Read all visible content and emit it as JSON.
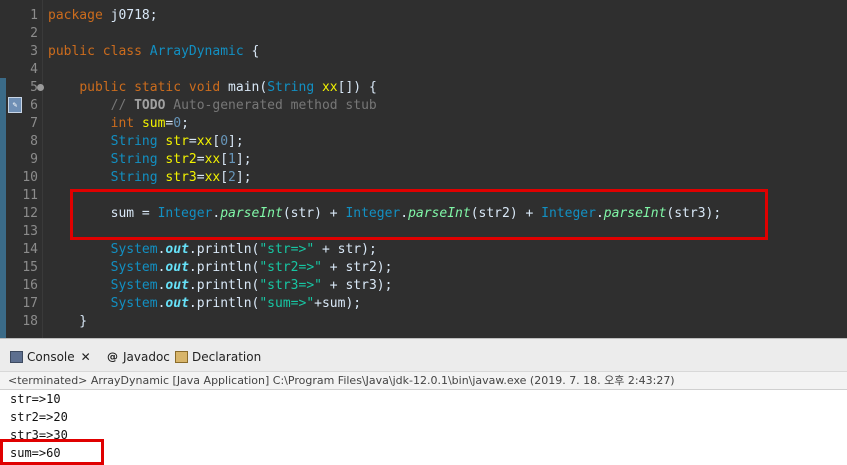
{
  "editor": {
    "lines": [
      {
        "n": "1",
        "tokens": [
          [
            "kw",
            "package"
          ],
          [
            "plain",
            " j0718;"
          ]
        ]
      },
      {
        "n": "2",
        "tokens": []
      },
      {
        "n": "3",
        "tokens": [
          [
            "kw",
            "public"
          ],
          [
            "plain",
            " "
          ],
          [
            "kw",
            "class"
          ],
          [
            "plain",
            " "
          ],
          [
            "ty",
            "ArrayDynamic"
          ],
          [
            "plain",
            " {"
          ]
        ]
      },
      {
        "n": "4",
        "tokens": []
      },
      {
        "n": "5",
        "tokens": [
          [
            "plain",
            "    "
          ],
          [
            "kw",
            "public"
          ],
          [
            "plain",
            " "
          ],
          [
            "kw",
            "static"
          ],
          [
            "plain",
            " "
          ],
          [
            "kw",
            "void"
          ],
          [
            "plain",
            " "
          ],
          [
            "plain",
            "main("
          ],
          [
            "ty",
            "String"
          ],
          [
            "plain",
            " "
          ],
          [
            "var",
            "xx"
          ],
          [
            "plain",
            "[]) {"
          ]
        ]
      },
      {
        "n": "6",
        "tokens": [
          [
            "plain",
            "        "
          ],
          [
            "cm",
            "// "
          ],
          [
            "todo",
            "TODO"
          ],
          [
            "cm",
            " Auto-generated method stub"
          ]
        ]
      },
      {
        "n": "7",
        "tokens": [
          [
            "plain",
            "        "
          ],
          [
            "kw",
            "int"
          ],
          [
            "plain",
            " "
          ],
          [
            "var",
            "sum"
          ],
          [
            "plain",
            "="
          ],
          [
            "num",
            "0"
          ],
          [
            "plain",
            ";"
          ]
        ]
      },
      {
        "n": "8",
        "tokens": [
          [
            "plain",
            "        "
          ],
          [
            "ty",
            "String"
          ],
          [
            "plain",
            " "
          ],
          [
            "var",
            "str"
          ],
          [
            "plain",
            "="
          ],
          [
            "var",
            "xx"
          ],
          [
            "plain",
            "["
          ],
          [
            "num",
            "0"
          ],
          [
            "plain",
            "];"
          ]
        ]
      },
      {
        "n": "9",
        "tokens": [
          [
            "plain",
            "        "
          ],
          [
            "ty",
            "String"
          ],
          [
            "plain",
            " "
          ],
          [
            "var",
            "str2"
          ],
          [
            "plain",
            "="
          ],
          [
            "var",
            "xx"
          ],
          [
            "plain",
            "["
          ],
          [
            "num",
            "1"
          ],
          [
            "plain",
            "];"
          ]
        ]
      },
      {
        "n": "10",
        "tokens": [
          [
            "plain",
            "        "
          ],
          [
            "ty",
            "String"
          ],
          [
            "plain",
            " "
          ],
          [
            "var",
            "str3"
          ],
          [
            "plain",
            "="
          ],
          [
            "var",
            "xx"
          ],
          [
            "plain",
            "["
          ],
          [
            "num",
            "2"
          ],
          [
            "plain",
            "];"
          ]
        ]
      },
      {
        "n": "11",
        "tokens": []
      },
      {
        "n": "12",
        "tokens": [
          [
            "plain",
            "        sum = "
          ],
          [
            "ty",
            "Integer"
          ],
          [
            "plain",
            "."
          ],
          [
            "mth",
            "parseInt"
          ],
          [
            "plain",
            "(str) + "
          ],
          [
            "ty",
            "Integer"
          ],
          [
            "plain",
            "."
          ],
          [
            "mth",
            "parseInt"
          ],
          [
            "plain",
            "(str2) + "
          ],
          [
            "ty",
            "Integer"
          ],
          [
            "plain",
            "."
          ],
          [
            "mth",
            "parseInt"
          ],
          [
            "plain",
            "(str3);"
          ]
        ]
      },
      {
        "n": "13",
        "tokens": []
      },
      {
        "n": "14",
        "tokens": [
          [
            "plain",
            "        "
          ],
          [
            "ty",
            "System"
          ],
          [
            "plain",
            "."
          ],
          [
            "fld",
            "out"
          ],
          [
            "plain",
            ".println("
          ],
          [
            "str",
            "\"str=>\""
          ],
          [
            "plain",
            " + str);"
          ]
        ]
      },
      {
        "n": "15",
        "tokens": [
          [
            "plain",
            "        "
          ],
          [
            "ty",
            "System"
          ],
          [
            "plain",
            "."
          ],
          [
            "fld",
            "out"
          ],
          [
            "plain",
            ".println("
          ],
          [
            "str",
            "\"str2=>\""
          ],
          [
            "plain",
            " + str2);"
          ]
        ]
      },
      {
        "n": "16",
        "tokens": [
          [
            "plain",
            "        "
          ],
          [
            "ty",
            "System"
          ],
          [
            "plain",
            "."
          ],
          [
            "fld",
            "out"
          ],
          [
            "plain",
            ".println("
          ],
          [
            "str",
            "\"str3=>\""
          ],
          [
            "plain",
            " + str3);"
          ]
        ]
      },
      {
        "n": "17",
        "tokens": [
          [
            "plain",
            "        "
          ],
          [
            "ty",
            "System"
          ],
          [
            "plain",
            "."
          ],
          [
            "fld",
            "out"
          ],
          [
            "plain",
            ".println("
          ],
          [
            "str",
            "\"sum=>\""
          ],
          [
            "plain",
            "+sum);"
          ]
        ]
      },
      {
        "n": "18",
        "tokens": [
          [
            "plain",
            "    }"
          ]
        ]
      }
    ]
  },
  "console": {
    "tabs": [
      {
        "label": "Console",
        "icon": "console-icon",
        "active": true
      },
      {
        "label": "Javadoc",
        "icon": "javadoc-icon",
        "active": false
      },
      {
        "label": "Declaration",
        "icon": "declaration-icon",
        "active": false
      }
    ],
    "status": "<terminated> ArrayDynamic [Java Application] C:\\Program Files\\Java\\jdk-12.0.1\\bin\\javaw.exe (2019. 7. 18. 오후 2:43:27)",
    "output": [
      "str=>10",
      "str2=>20",
      "str3=>30",
      "sum=>60"
    ]
  },
  "colors": {
    "editor_bg": "#2f2f2f",
    "highlight": "#e00000"
  }
}
